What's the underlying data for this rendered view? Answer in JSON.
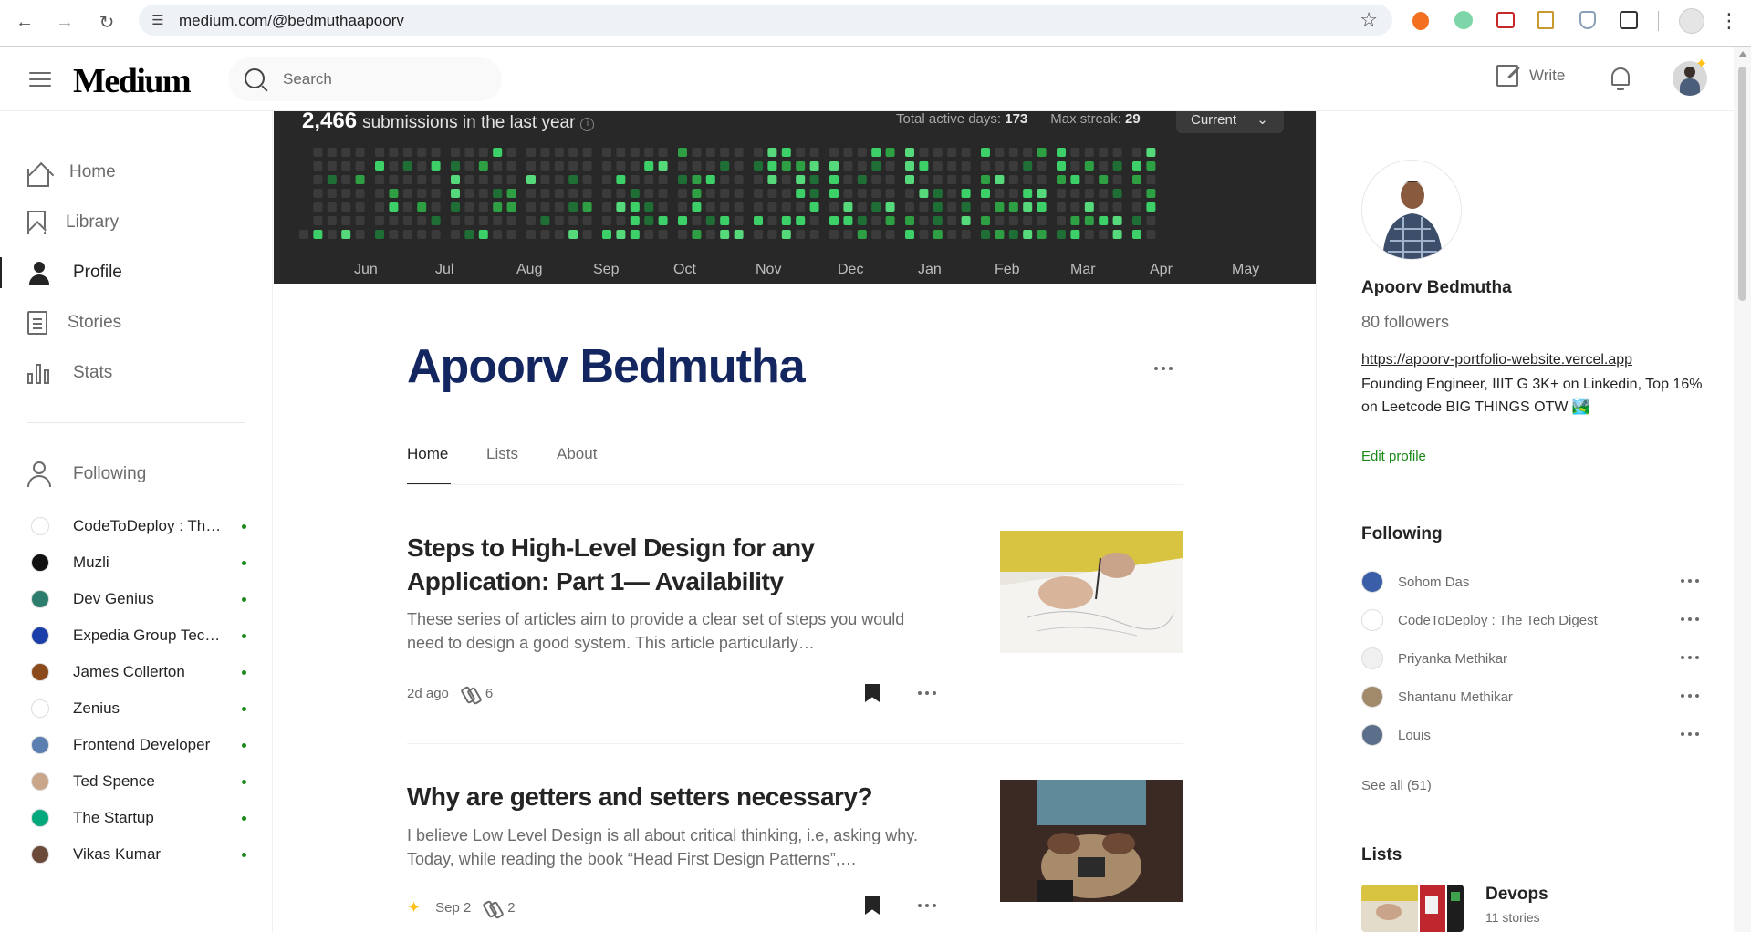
{
  "browser": {
    "url": "medium.com/@bedmuthaapoorv"
  },
  "header": {
    "logo": "Medium",
    "search_placeholder": "Search",
    "write_label": "Write"
  },
  "sidebar": {
    "items": [
      {
        "label": "Home",
        "icon": "home-icon"
      },
      {
        "label": "Library",
        "icon": "bookmark-icon"
      },
      {
        "label": "Profile",
        "icon": "person-icon"
      },
      {
        "label": "Stories",
        "icon": "document-icon"
      },
      {
        "label": "Stats",
        "icon": "bar-chart-icon"
      }
    ],
    "following_label": "Following",
    "following": [
      {
        "name": "CodeToDeploy : The Tech Digest",
        "color": "#ffffff"
      },
      {
        "name": "Muzli",
        "color": "#111111"
      },
      {
        "name": "Dev Genius",
        "color": "#2d7d6f"
      },
      {
        "name": "Expedia Group Technology",
        "color": "#1b3fa8"
      },
      {
        "name": "James Collerton",
        "color": "#8a4a1c"
      },
      {
        "name": "Zenius",
        "color": "#ffffff"
      },
      {
        "name": "Frontend Developer",
        "color": "#5a7fb0"
      },
      {
        "name": "Ted Spence",
        "color": "#c9a58a"
      },
      {
        "name": "The Startup",
        "color": "#03a87c"
      },
      {
        "name": "Vikas Kumar",
        "color": "#6b4a3a"
      }
    ]
  },
  "heatmap": {
    "submissions": "2,466",
    "submissions_text": "submissions in the last year",
    "active_days_label": "Total active days:",
    "active_days": "173",
    "max_streak_label": "Max streak:",
    "max_streak": "29",
    "current_label": "Current",
    "months": [
      "Jun",
      "Jul",
      "Aug",
      "Sep",
      "Oct",
      "Nov",
      "Dec",
      "Jan",
      "Feb",
      "Mar",
      "Apr",
      "May"
    ]
  },
  "profile": {
    "name": "Apoorv Bedmutha",
    "tabs": [
      "Home",
      "Lists",
      "About"
    ]
  },
  "posts": [
    {
      "title": "Steps to High-Level Design for any Application: Part 1— Availability",
      "subtitle": "These series of articles aim to provide a clear set of steps you would need to design a good system. This article particularly…",
      "date": "2d ago",
      "claps": "6",
      "member_only": false
    },
    {
      "title": "Why are getters and setters necessary?",
      "subtitle": "I believe Low Level Design is all about critical thinking, i.e, asking why. Today, while reading the book “Head First Design Patterns”,…",
      "date": "Sep 2",
      "claps": "2",
      "member_only": true
    }
  ],
  "right": {
    "name": "Apoorv Bedmutha",
    "followers": "80 followers",
    "link": "https://apoorv-portfolio-website.vercel.app",
    "bio": "Founding Engineer, IIIT G 3K+ on Linkedin, Top 16% on Leetcode BIG THINGS OTW 🏞️",
    "edit_label": "Edit profile",
    "following_title": "Following",
    "following": [
      {
        "name": "Sohom Das"
      },
      {
        "name": "CodeToDeploy : The Tech Digest"
      },
      {
        "name": "Priyanka Methikar"
      },
      {
        "name": "Shantanu Methikar"
      },
      {
        "name": "Louis"
      }
    ],
    "see_all": "See all (51)",
    "lists_title": "Lists",
    "list": {
      "title": "Devops",
      "count": "11 stories"
    }
  },
  "colors": {
    "accent_green": "#1a8917",
    "name_blue": "#13265f",
    "heatmap_bg": "#282828"
  }
}
